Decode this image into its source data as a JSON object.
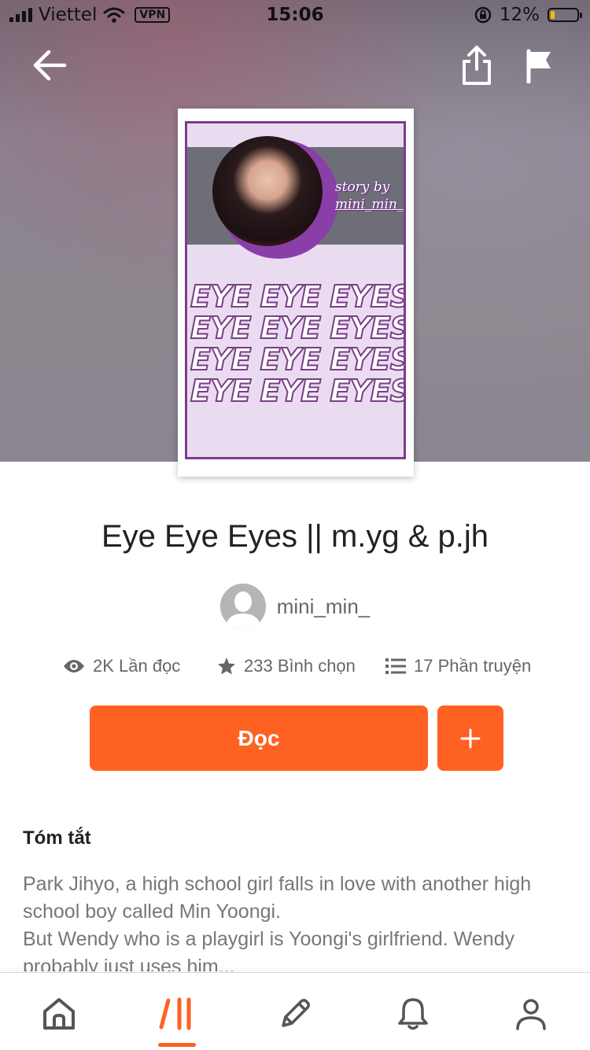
{
  "status_bar": {
    "carrier": "Viettel",
    "vpn": "VPN",
    "time": "15:06",
    "battery": "12%"
  },
  "header": {
    "back_icon": "arrow-left-icon",
    "share_icon": "share-icon",
    "report_icon": "flag-icon"
  },
  "cover": {
    "byline_1": "story by",
    "byline_2": "mini_min_",
    "words": [
      "EYE EYE EYES",
      "EYE EYE EYES",
      "EYE EYE EYES",
      "EYE EYE EYES"
    ]
  },
  "story": {
    "title": "Eye Eye Eyes || m.yg & p.jh",
    "author": "mini_min_"
  },
  "stats": {
    "reads": "2K Lần đọc",
    "votes": "233 Bình chọn",
    "parts": "17 Phần truyện"
  },
  "actions": {
    "read_label": "Đọc",
    "add_label": "+"
  },
  "summary": {
    "heading": "Tóm tắt",
    "line_1": "Park Jihyo, a high school girl falls in love with another high school boy called Min Yoongi.",
    "line_2": "But Wendy who is a playgirl is Yoongi's girlfriend. Wendy probably just uses him..."
  },
  "bottom_nav": {
    "items": [
      "home-icon",
      "library-icon",
      "write-icon",
      "notifications-icon",
      "profile-icon"
    ],
    "active": "library-icon"
  },
  "colors": {
    "accent": "#ff6122",
    "cover_purple": "#7a3d8a"
  }
}
